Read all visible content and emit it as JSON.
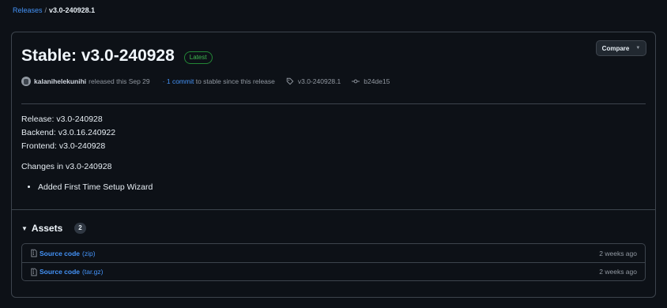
{
  "breadcrumb": {
    "parent": "Releases",
    "separator": "/",
    "current": "v3.0-240928.1"
  },
  "release": {
    "title": "Stable: v3.0-240928",
    "badge": "Latest",
    "compare_label": "Compare",
    "author": "kalanihelekunihi",
    "released_text": "released this Sep 29",
    "commits_prefix": "·",
    "commits_link": "1 commit",
    "commits_suffix": "to stable since this release",
    "tag": "v3.0-240928.1",
    "sha": "b24de15"
  },
  "notes": {
    "lines": [
      "Release: v3.0-240928",
      "Backend: v3.0.16.240922",
      "Frontend: v3.0-240928"
    ],
    "changes_heading": "Changes in v3.0-240928",
    "bullets": [
      "Added First Time Setup Wizard"
    ]
  },
  "assets": {
    "title": "Assets",
    "count": "2",
    "items": [
      {
        "name": "Source code",
        "ext": "(zip)",
        "date": "2 weeks ago"
      },
      {
        "name": "Source code",
        "ext": "(tar.gz)",
        "date": "2 weeks ago"
      }
    ]
  },
  "icons": {
    "avatar": "avatar",
    "tag": "tag-icon",
    "commit": "git-commit-icon",
    "file-zip": "file-zip-icon",
    "caret": "triangle-down-icon"
  },
  "colors": {
    "background": "#0d1117",
    "border": "#3d444d",
    "link": "#4493f8",
    "badge_green": "#3fb950",
    "muted": "#9198a1"
  }
}
